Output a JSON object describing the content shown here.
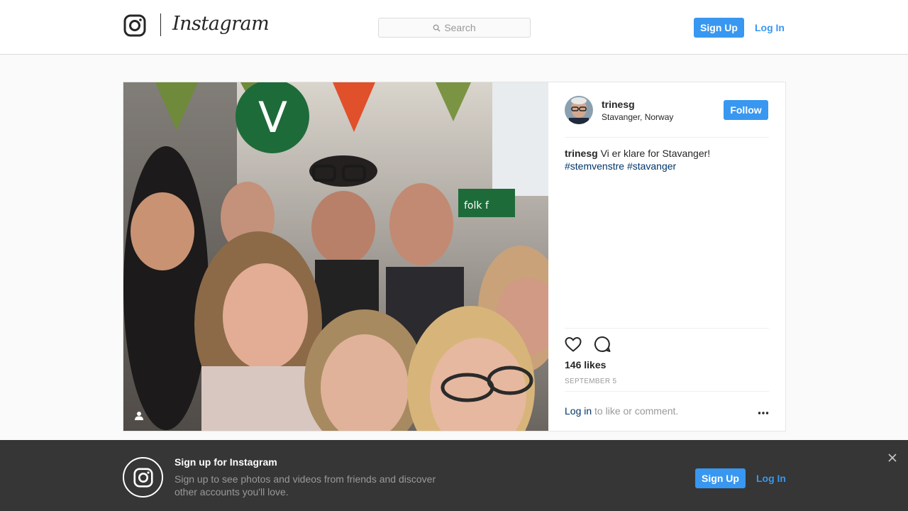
{
  "header": {
    "brand": "Instagram",
    "search_placeholder": "Search",
    "signup_label": "Sign Up",
    "login_label": "Log In"
  },
  "post": {
    "username": "trinesg",
    "location": "Stavanger, Norway",
    "follow_label": "Follow",
    "caption_user": "trinesg",
    "caption_text": "Vi er klare for Stavanger!",
    "hashtags": [
      "#stemvenstre",
      "#stavanger"
    ],
    "likes": "146 likes",
    "date": "SEPTEMBER 5",
    "login_link": "Log in",
    "login_suffix": "to like or comment."
  },
  "banner": {
    "title": "Sign up for Instagram",
    "text": "Sign up to see photos and videos from friends and discover other accounts you'll love.",
    "signup_label": "Sign Up",
    "login_label": "Log In"
  },
  "icons": {
    "logo": "instagram-glyph-icon",
    "search": "search-icon",
    "tag": "user-tag-icon",
    "like": "heart-icon",
    "comment": "comment-icon",
    "more": "more-options-icon",
    "close": "close-icon"
  },
  "colors": {
    "accent": "#3897f0",
    "link": "#003569",
    "banner_bg": "#363636"
  }
}
